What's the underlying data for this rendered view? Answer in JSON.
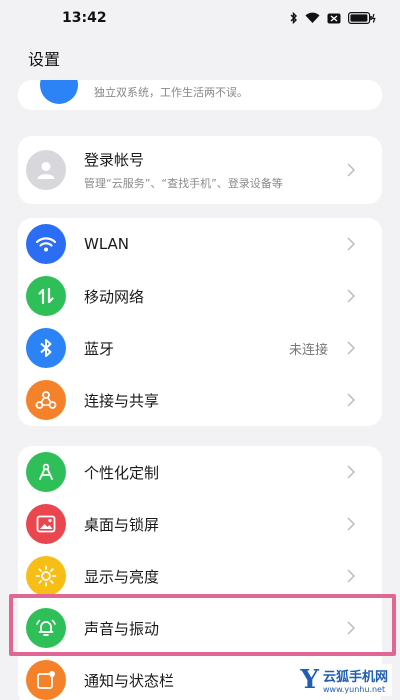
{
  "status_bar": {
    "time": "13:42"
  },
  "header": {
    "title": "设置"
  },
  "top_card": {
    "subtitle": "独立双系统，工作生活两不误。"
  },
  "account": {
    "label": "登录帐号",
    "subtitle": "管理“云服务”、“查找手机”、登录设备等"
  },
  "network_items": [
    {
      "label": "WLAN",
      "value": "",
      "icon": "wifi-icon",
      "color": "#2b6df5"
    },
    {
      "label": "移动网络",
      "value": "",
      "icon": "mobile-data-icon",
      "color": "#2fbf58"
    },
    {
      "label": "蓝牙",
      "value": "未连接",
      "icon": "bluetooth-icon",
      "color": "#2b83f6"
    },
    {
      "label": "连接与共享",
      "value": "",
      "icon": "share-icon",
      "color": "#f5822a"
    }
  ],
  "display_items": [
    {
      "label": "个性化定制",
      "icon": "personalize-icon",
      "color": "#2fbf58"
    },
    {
      "label": "桌面与锁屏",
      "icon": "wallpaper-icon",
      "color": "#ea4650"
    },
    {
      "label": "显示与亮度",
      "icon": "brightness-icon",
      "color": "#f7be16"
    },
    {
      "label": "声音与振动",
      "icon": "bell-icon",
      "color": "#2fbf58"
    },
    {
      "label": "通知与状态栏",
      "icon": "notification-icon",
      "color": "#f5822a"
    }
  ],
  "watermark": {
    "logo": "Y",
    "name": "云狐手机网",
    "url": "www.yunhu.net"
  },
  "highlight_color": "#e06693"
}
